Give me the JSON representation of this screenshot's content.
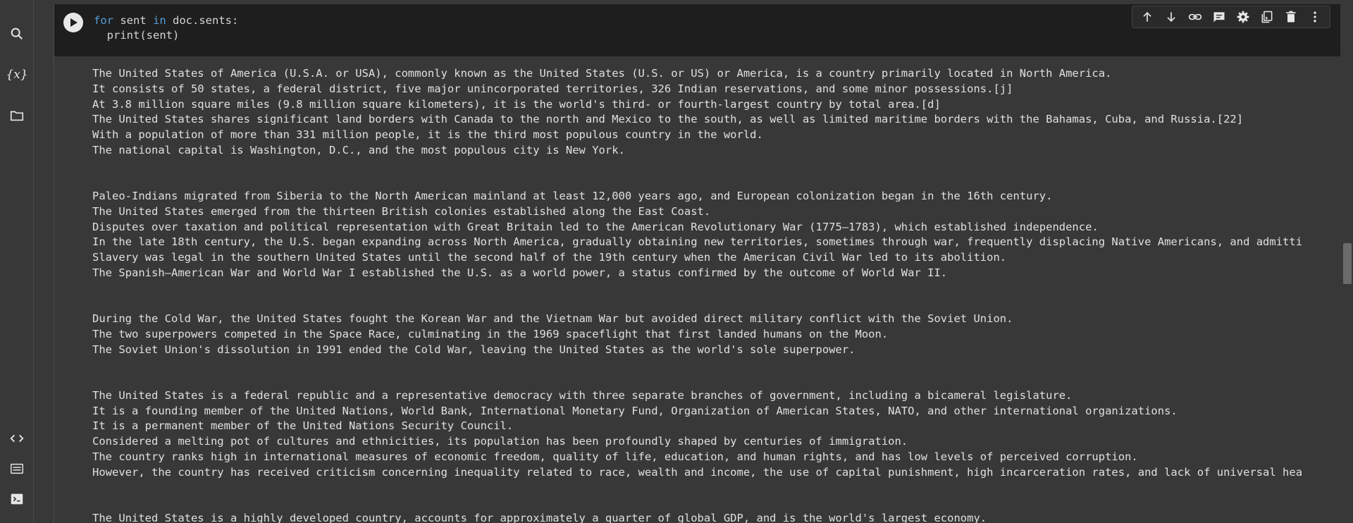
{
  "rail": {
    "var_label": "{x}"
  },
  "code": {
    "line1_kw1": "for",
    "line1_mid": " sent ",
    "line1_kw2": "in",
    "line1_rest": " doc.sents:",
    "line2": "  print(sent)"
  },
  "output": {
    "lines": [
      "The United States of America (U.S.A. or USA), commonly known as the United States (U.S. or US) or America, is a country primarily located in North America.",
      "It consists of 50 states, a federal district, five major unincorporated territories, 326 Indian reservations, and some minor possessions.[j]",
      "At 3.8 million square miles (9.8 million square kilometers), it is the world's third- or fourth-largest country by total area.[d]",
      "The United States shares significant land borders with Canada to the north and Mexico to the south, as well as limited maritime borders with the Bahamas, Cuba, and Russia.[22]",
      "With a population of more than 331 million people, it is the third most populous country in the world.",
      "The national capital is Washington, D.C., and the most populous city is New York.",
      "",
      "",
      "Paleo-Indians migrated from Siberia to the North American mainland at least 12,000 years ago, and European colonization began in the 16th century.",
      "The United States emerged from the thirteen British colonies established along the East Coast.",
      "Disputes over taxation and political representation with Great Britain led to the American Revolutionary War (1775–1783), which established independence.",
      "In the late 18th century, the U.S. began expanding across North America, gradually obtaining new territories, sometimes through war, frequently displacing Native Americans, and admitti",
      "Slavery was legal in the southern United States until the second half of the 19th century when the American Civil War led to its abolition.",
      "The Spanish–American War and World War I established the U.S. as a world power, a status confirmed by the outcome of World War II.",
      "",
      "",
      "During the Cold War, the United States fought the Korean War and the Vietnam War but avoided direct military conflict with the Soviet Union.",
      "The two superpowers competed in the Space Race, culminating in the 1969 spaceflight that first landed humans on the Moon.",
      "The Soviet Union's dissolution in 1991 ended the Cold War, leaving the United States as the world's sole superpower.",
      "",
      "",
      "The United States is a federal republic and a representative democracy with three separate branches of government, including a bicameral legislature.",
      "It is a founding member of the United Nations, World Bank, International Monetary Fund, Organization of American States, NATO, and other international organizations.",
      "It is a permanent member of the United Nations Security Council.",
      "Considered a melting pot of cultures and ethnicities, its population has been profoundly shaped by centuries of immigration.",
      "The country ranks high in international measures of economic freedom, quality of life, education, and human rights, and has low levels of perceived corruption.",
      "However, the country has received criticism concerning inequality related to race, wealth and income, the use of capital punishment, high incarceration rates, and lack of universal hea",
      "",
      "",
      "The United States is a highly developed country, accounts for approximately a quarter of global GDP, and is the world's largest economy."
    ]
  },
  "icons": {
    "search": "search-icon",
    "variables": "variables-icon",
    "files": "folder-icon",
    "code_snippets": "code-icon",
    "command_palette": "keyboard-icon",
    "terminal": "terminal-icon",
    "run": "play-icon",
    "toolbar": [
      "arrow-up-icon",
      "arrow-down-icon",
      "link-icon",
      "comment-icon",
      "gear-icon",
      "mirror-cell-icon",
      "trash-icon",
      "more-vert-icon"
    ]
  },
  "colors": {
    "background": "#383838",
    "code_background": "#1e1e1e",
    "keyword": "#569cd6",
    "text": "#e0e0e0"
  }
}
